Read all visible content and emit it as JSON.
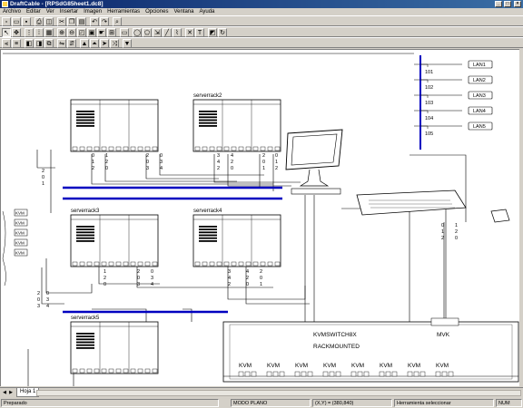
{
  "window": {
    "title": "DraftCable - [RPSdG85heet1.dc8]",
    "controls": [
      "_",
      "□",
      "×"
    ]
  },
  "menu": [
    "Archivo",
    "Editar",
    "Ver",
    "Insertar",
    "Imagen",
    "Herramientas",
    "Opciones",
    "Ventana",
    "Ayuda"
  ],
  "drawing": {
    "servers": [
      {
        "name": "serverrack1",
        "label": ""
      },
      {
        "name": "serverrack2",
        "label": "serverrack2"
      },
      {
        "name": "serverrack3",
        "label": "serverrack3"
      },
      {
        "name": "serverrack4",
        "label": "serverrack4"
      },
      {
        "name": "serverrack5",
        "label": "serverrack5"
      }
    ],
    "lan_ports": [
      "101",
      "102",
      "103",
      "104",
      "105"
    ],
    "lan_labels": [
      "LAN1",
      "LAN2",
      "LAN3",
      "LAN4",
      "LAN5"
    ],
    "left_ports": [
      "KVM",
      "KVM",
      "KVM",
      "KVM",
      "KVM"
    ],
    "kvm_switch": {
      "name": "KVMSWITCH8X",
      "mount": "RACKMOUNTED",
      "ports": [
        "KVM",
        "KVM",
        "KVM",
        "KVM",
        "KVM",
        "KVM",
        "KVM",
        "KVM"
      ],
      "mvk": "MVK"
    },
    "cable_codes": [
      "2",
      "0",
      "1",
      "2",
      "0",
      "3",
      "4"
    ]
  },
  "sheet_tabs": {
    "active": "Hoja 1"
  },
  "status": {
    "mode": "Preparado",
    "drawmode": "MODO PLANO",
    "coords": "(X,Y) = (380,840)",
    "hint": "Herramienta seleccionar",
    "num": "NUM"
  },
  "colors": {
    "bus": "#0000c0",
    "frame": "#000000",
    "titlebar": "#0a246a"
  }
}
